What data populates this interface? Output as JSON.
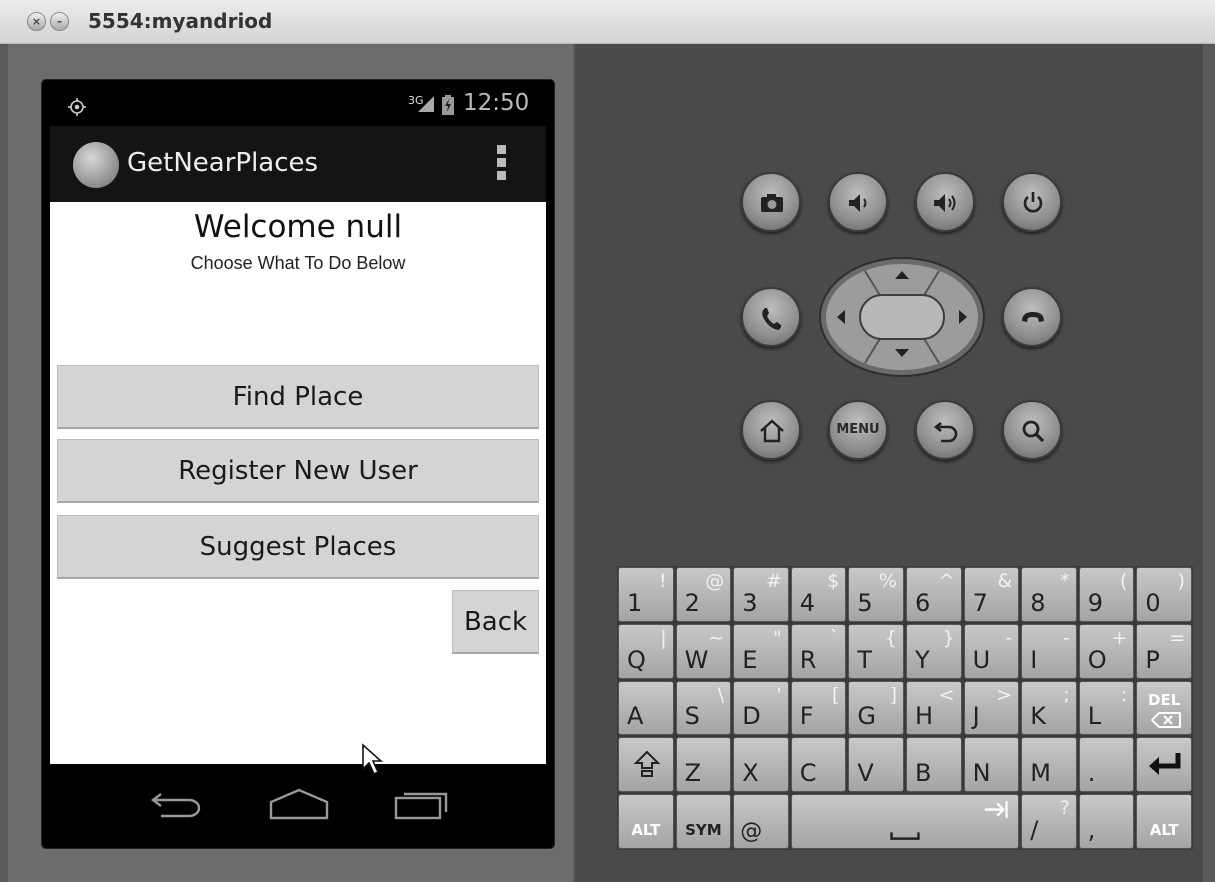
{
  "window": {
    "title": "5554:myandriod",
    "close_glyph": "×",
    "minimize_glyph": "–"
  },
  "status_bar": {
    "network": "3G",
    "time": "12:50"
  },
  "action_bar": {
    "title": "GetNearPlaces"
  },
  "screen": {
    "welcome": "Welcome  null",
    "subtitle": "Choose What To Do Below",
    "buttons": [
      "Find Place",
      "Register New User",
      "Suggest Places"
    ],
    "back": "Back"
  },
  "controls": {
    "menu_label": "MENU"
  },
  "keyboard": {
    "row1": [
      {
        "main": "1",
        "sub": "!"
      },
      {
        "main": "2",
        "sub": "@"
      },
      {
        "main": "3",
        "sub": "#"
      },
      {
        "main": "4",
        "sub": "$"
      },
      {
        "main": "5",
        "sub": "%"
      },
      {
        "main": "6",
        "sub": "^"
      },
      {
        "main": "7",
        "sub": "&"
      },
      {
        "main": "8",
        "sub": "*"
      },
      {
        "main": "9",
        "sub": "("
      },
      {
        "main": "0",
        "sub": ")"
      }
    ],
    "row2": [
      {
        "main": "Q",
        "sub": "|"
      },
      {
        "main": "W",
        "sub": "~"
      },
      {
        "main": "E",
        "sub": "\""
      },
      {
        "main": "R",
        "sub": "`"
      },
      {
        "main": "T",
        "sub": "{"
      },
      {
        "main": "Y",
        "sub": "}"
      },
      {
        "main": "U",
        "sub": "-"
      },
      {
        "main": "I",
        "sub": "-"
      },
      {
        "main": "O",
        "sub": "+"
      },
      {
        "main": "P",
        "sub": "="
      }
    ],
    "row3": [
      {
        "main": "A",
        "sub": ""
      },
      {
        "main": "S",
        "sub": "\\"
      },
      {
        "main": "D",
        "sub": "'"
      },
      {
        "main": "F",
        "sub": "["
      },
      {
        "main": "G",
        "sub": "]"
      },
      {
        "main": "H",
        "sub": "<"
      },
      {
        "main": "J",
        "sub": ">"
      },
      {
        "main": "K",
        "sub": ";"
      },
      {
        "main": "L",
        "sub": ":"
      }
    ],
    "row4": [
      {
        "main": "Z",
        "sub": ""
      },
      {
        "main": "X",
        "sub": ""
      },
      {
        "main": "C",
        "sub": ""
      },
      {
        "main": "V",
        "sub": ""
      },
      {
        "main": "B",
        "sub": ""
      },
      {
        "main": "N",
        "sub": ""
      },
      {
        "main": "M",
        "sub": ""
      },
      {
        "main": ".",
        "sub": ""
      }
    ],
    "row5": {
      "alt_left": "ALT",
      "sym": "SYM",
      "at": "@",
      "slash": "/",
      "slash_sub": "?",
      "comma": ",",
      "alt_right": "ALT"
    },
    "del_label": "DEL"
  }
}
